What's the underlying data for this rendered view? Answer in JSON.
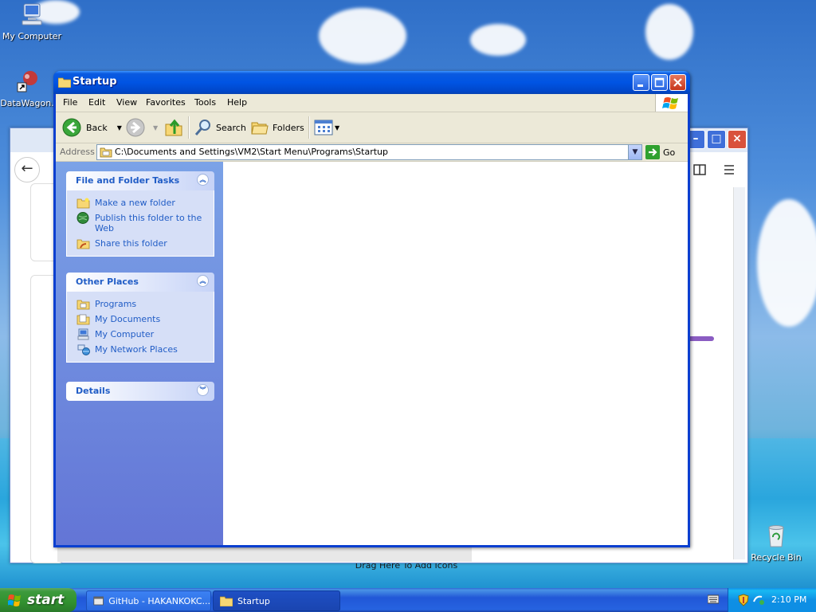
{
  "desktop": {
    "icons": [
      {
        "label": "My Computer"
      },
      {
        "label": "DataWagon."
      },
      {
        "label": "Recycle Bin"
      }
    ],
    "drag_here_text": "Drag Here To Add Icons"
  },
  "explorer": {
    "title": "Startup",
    "menu": [
      "File",
      "Edit",
      "View",
      "Favorites",
      "Tools",
      "Help"
    ],
    "toolbar": {
      "back_label": "Back",
      "search_label": "Search",
      "folders_label": "Folders"
    },
    "address": {
      "label": "Address",
      "path": "C:\\Documents and Settings\\VM2\\Start Menu\\Programs\\Startup",
      "go_label": "Go"
    },
    "panels": {
      "file_tasks": {
        "title": "File and Folder Tasks",
        "items": [
          "Make a new folder",
          "Publish this folder to the Web",
          "Share this folder"
        ]
      },
      "other_places": {
        "title": "Other Places",
        "items": [
          "Programs",
          "My Documents",
          "My Computer",
          "My Network Places"
        ]
      },
      "details": {
        "title": "Details"
      }
    }
  },
  "taskbar": {
    "start_label": "start",
    "buttons": [
      {
        "label": "GitHub - HAKANKOKC..."
      },
      {
        "label": "Startup"
      }
    ],
    "clock": "2:10 PM"
  },
  "colors": {
    "xp_blue": "#0054e3",
    "task_link": "#215dc6",
    "start_green": "#31912f"
  }
}
